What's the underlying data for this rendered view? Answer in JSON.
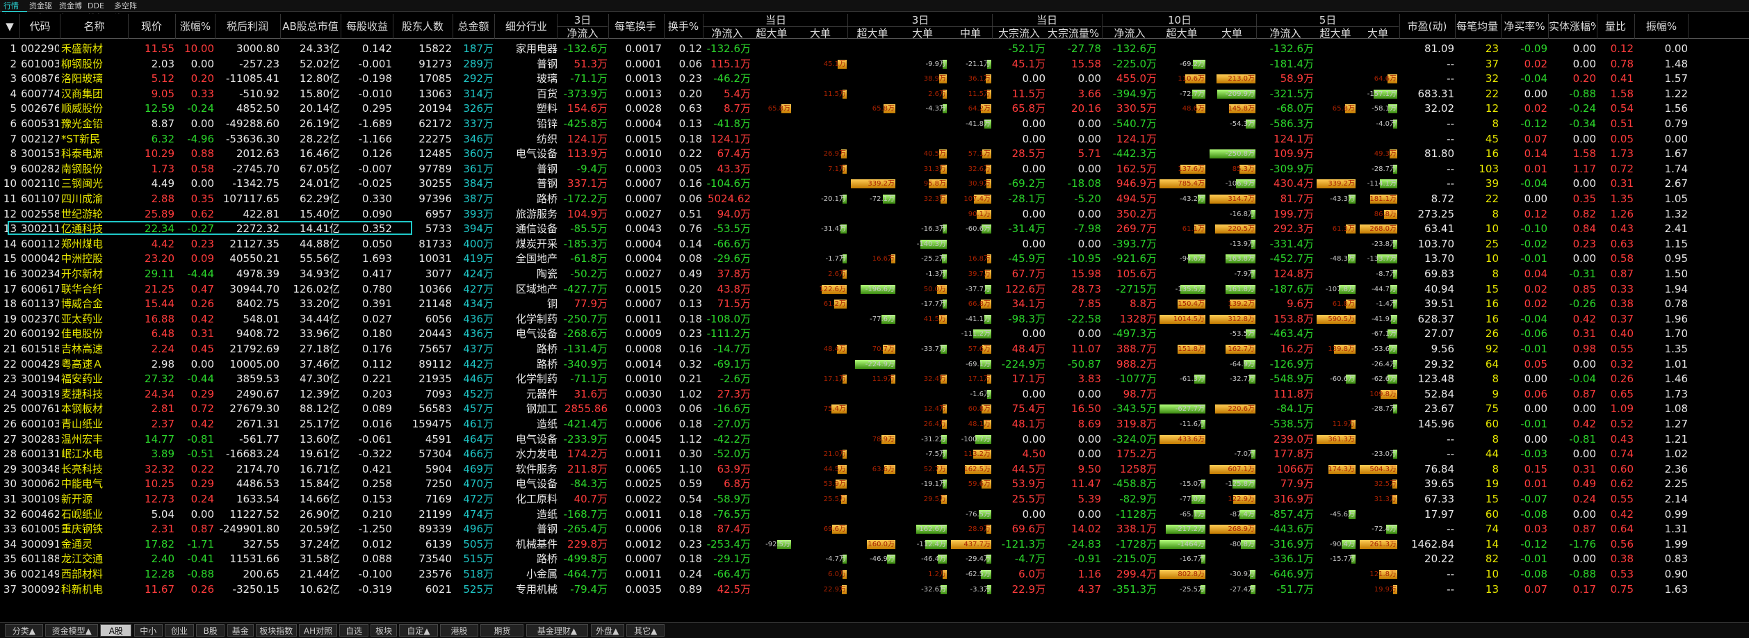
{
  "top_tabs": [
    "行情报价",
    "资金驱动力",
    "资金博弈",
    "DDE排名",
    "多空阵线"
  ],
  "headers": {
    "sort": "▼",
    "code": "代码",
    "name": "名称",
    "price": "现价",
    "chg": "涨幅%",
    "profit": "税后利润",
    "ab_total": "AB股总市值",
    "eps": "每股收益",
    "holders": "股东人数",
    "total_amt": "总金额",
    "industry": "细分行业",
    "d3": "3日",
    "d3_net": "净流入",
    "per_trade": "每笔换手",
    "turnover": "换手%",
    "today": "当日",
    "today_net": "净流入",
    "today_super": "超大单",
    "today_big": "大单",
    "d3b": "3日",
    "d3b_super": "超大单",
    "d3b_big": "大单",
    "d3b_mid": "中单",
    "today2": "当日",
    "block_in": "大宗流入",
    "block_pct": "大宗流量%",
    "d10": "10日",
    "d10_net": "净流入",
    "d10_super": "超大单",
    "d10_big": "大单",
    "d5": "5日",
    "d5_net": "净流入",
    "d5_super": "超大单",
    "d5_big": "大单",
    "pe": "市盈(动)",
    "avg_per_trade": "每笔均量",
    "net_rate": "净买率%",
    "body_chg": "实体涨幅%",
    "vol_ratio": "量比",
    "amplitude": "振幅%"
  },
  "colors": {
    "red": "#ff3c3c",
    "green": "#2bd52b",
    "cyan": "#1fc8c8",
    "yellow": "#e8e800",
    "orange_bar": "#e89a10",
    "green_bar": "#6ad43a",
    "selection": "#1fc8c8"
  },
  "selected_row": 13,
  "rows": [
    [
      "1",
      "002290",
      "禾盛新材",
      "11.55",
      "10.00",
      "3000.80",
      "24.33亿",
      "0.142",
      "15822",
      "187万",
      "家用电器",
      "-132.6万",
      "0.0017",
      "0.12",
      "-132.6万",
      "",
      "",
      "",
      "",
      "",
      "-52.1万",
      "-27.78",
      "-132.6万",
      "",
      "",
      "-132.6万",
      "",
      "",
      "81.09",
      "23",
      "-0.09",
      "0.00",
      "0.12",
      "0.00"
    ],
    [
      "2",
      "601003",
      "柳钢股份",
      "2.03",
      "0.00",
      "-257.23",
      "52.02亿",
      "-0.001",
      "91273",
      "289万",
      "普钢",
      "51.3万",
      "0.0001",
      "0.06",
      "115.1万",
      "",
      "45.1万",
      "",
      "-9.9万",
      "-21.1万",
      "45.1万",
      "15.58",
      "-225.0万",
      "-69.2万",
      "",
      "-181.4万",
      "",
      "",
      "--",
      "37",
      "0.02",
      "0.00",
      "0.78",
      "1.48"
    ],
    [
      "3",
      "600876",
      "洛阳玻璃",
      "5.12",
      "0.20",
      "-11085.41",
      "12.80亿",
      "-0.198",
      "17085",
      "292万",
      "玻璃",
      "-71.1万",
      "0.0013",
      "0.23",
      "-46.2万",
      "",
      "",
      "",
      "38.9万",
      "36.1万",
      "0.00",
      "0.00",
      "455.0万",
      "110.6万",
      "213.0万",
      "58.9万",
      "",
      "64.6万",
      "--",
      "32",
      "-0.04",
      "0.20",
      "0.41",
      "1.57"
    ],
    [
      "4",
      "600774",
      "汉商集团",
      "9.05",
      "0.33",
      "-510.92",
      "15.80亿",
      "-0.010",
      "13063",
      "314万",
      "百货",
      "-373.9万",
      "0.0013",
      "0.20",
      "5.4万",
      "",
      "11.5万",
      "",
      "2.6万",
      "11.5万",
      "11.5万",
      "3.66",
      "-394.9万",
      "-72.7万",
      "-209.9万",
      "-321.5万",
      "",
      "-157.1万",
      "683.31",
      "22",
      "0.00",
      "-0.88",
      "1.58",
      "1.22"
    ],
    [
      "5",
      "002676",
      "顺威股份",
      "12.59",
      "-0.24",
      "4852.50",
      "20.14亿",
      "0.295",
      "20194",
      "326万",
      "塑料",
      "154.6万",
      "0.0028",
      "0.63",
      "8.7万",
      "65.8万",
      "",
      "65.8万",
      "-4.3万",
      "64.2万",
      "65.8万",
      "20.16",
      "330.5万",
      "48.6万",
      "145.8万",
      "-68.0万",
      "65.8万",
      "-58.1万",
      "32.02",
      "12",
      "0.02",
      "-0.24",
      "0.54",
      "1.56"
    ],
    [
      "6",
      "600531",
      "豫光金铅",
      "8.87",
      "0.00",
      "-49288.60",
      "26.19亿",
      "-1.689",
      "62172",
      "337万",
      "铅锌",
      "-425.8万",
      "0.0004",
      "0.13",
      "-41.8万",
      "",
      "",
      "",
      "",
      "-41.8万",
      "0.00",
      "0.00",
      "-540.7万",
      "",
      "-54.3万",
      "-586.3万",
      "",
      "-4.0万",
      "--",
      "8",
      "-0.12",
      "-0.34",
      "0.51",
      "0.79"
    ],
    [
      "7",
      "002127",
      "*ST新民",
      "6.32",
      "-4.96",
      "-53636.30",
      "28.22亿",
      "-1.166",
      "22275",
      "346万",
      "纺织",
      "124.1万",
      "0.0015",
      "0.18",
      "124.1万",
      "",
      "",
      "",
      "",
      "",
      "0.00",
      "0.00",
      "124.1万",
      "",
      "",
      "124.1万",
      "",
      "",
      "--",
      "45",
      "0.07",
      "0.00",
      "0.05",
      "0.00"
    ],
    [
      "8",
      "300153",
      "科泰电源",
      "10.29",
      "0.88",
      "2012.63",
      "16.46亿",
      "0.126",
      "12485",
      "360万",
      "电气设备",
      "113.9万",
      "0.0010",
      "0.22",
      "67.4万",
      "",
      "26.9万",
      "",
      "40.5万",
      "57.1万",
      "28.5万",
      "5.71",
      "-442.3万",
      "",
      "-250.8万",
      "109.9万",
      "",
      "49.3万",
      "81.80",
      "16",
      "0.14",
      "1.58",
      "1.73",
      "1.67"
    ],
    [
      "9",
      "600282",
      "南钢股份",
      "1.73",
      "0.58",
      "-2745.70",
      "67.05亿",
      "-0.007",
      "97789",
      "361万",
      "普钢",
      "-9.4万",
      "0.0003",
      "0.05",
      "43.3万",
      "",
      "7.1万",
      "",
      "31.3万",
      "32.6万",
      "0.00",
      "0.00",
      "162.5万",
      "137.6万",
      "85.3万",
      "-309.9万",
      "",
      "-28.7万",
      "--",
      "103",
      "0.01",
      "1.17",
      "0.72",
      "1.74"
    ],
    [
      "10",
      "002110",
      "三钢闽光",
      "4.49",
      "0.00",
      "-1342.75",
      "24.01亿",
      "-0.025",
      "30255",
      "384万",
      "普钢",
      "337.1万",
      "0.0007",
      "0.16",
      "-104.6万",
      "",
      "",
      "339.2万",
      "95.8万",
      "30.9万",
      "-69.2万",
      "-18.08",
      "946.9万",
      "785.4万",
      "-106.9万",
      "430.4万",
      "339.2万",
      "-114.1万",
      "--",
      "39",
      "-0.04",
      "0.00",
      "0.31",
      "2.67"
    ],
    [
      "11",
      "601107",
      "四川成渝",
      "2.88",
      "0.35",
      "107117.65",
      "62.29亿",
      "0.330",
      "97396",
      "387万",
      "路桥",
      "-172.2万",
      "0.0007",
      "0.06",
      "5024.62",
      "",
      "-20.1万",
      "-72.1万",
      "32.3万",
      "107.4万",
      "-28.1万",
      "-5.20",
      "494.5万",
      "-43.2万",
      "314.7万",
      "81.7万",
      "-43.3万",
      "181.1万",
      "8.72",
      "22",
      "0.00",
      "0.35",
      "1.35",
      "1.05"
    ],
    [
      "12",
      "002558",
      "世纪游轮",
      "25.89",
      "0.62",
      "422.81",
      "15.40亿",
      "0.090",
      "6957",
      "393万",
      "旅游服务",
      "104.9万",
      "0.0027",
      "0.51",
      "94.0万",
      "",
      "",
      "",
      "",
      "90.1万",
      "0.00",
      "0.00",
      "350.2万",
      "",
      "-16.8万",
      "199.7万",
      "",
      "86.8万",
      "273.25",
      "8",
      "0.12",
      "0.82",
      "1.26",
      "1.32"
    ],
    [
      "13",
      "300211",
      "亿通科技",
      "22.34",
      "-0.27",
      "2272.32",
      "14.41亿",
      "0.352",
      "5733",
      "394万",
      "通信设备",
      "-85.5万",
      "0.0043",
      "0.76",
      "-53.5万",
      "",
      "-31.4万",
      "",
      "-16.3万",
      "-60.6万",
      "-31.4万",
      "-7.98",
      "269.7万",
      "61.1万",
      "220.5万",
      "292.3万",
      "61.3万",
      "268.0万",
      "63.41",
      "10",
      "-0.10",
      "0.84",
      "0.43",
      "2.41"
    ],
    [
      "14",
      "600112",
      "郑州煤电",
      "4.42",
      "0.23",
      "21127.35",
      "44.88亿",
      "0.050",
      "81733",
      "400万",
      "煤炭开采",
      "-185.3万",
      "0.0004",
      "0.14",
      "-66.6万",
      "",
      "",
      "",
      "-140.3万",
      "",
      "0.00",
      "0.00",
      "-393.7万",
      "",
      "-13.9万",
      "-331.4万",
      "",
      "-23.8万",
      "103.70",
      "25",
      "-0.02",
      "0.23",
      "0.63",
      "1.15"
    ],
    [
      "15",
      "000042",
      "中洲控股",
      "23.20",
      "0.09",
      "40550.21",
      "55.56亿",
      "1.693",
      "10031",
      "419万",
      "全国地产",
      "-61.8万",
      "0.0004",
      "0.08",
      "-29.6万",
      "",
      "-1.7万",
      "16.6万",
      "-25.2万",
      "16.8万",
      "-45.9万",
      "-10.95",
      "-921.6万",
      "-94.6万",
      "-163.8万",
      "-452.7万",
      "-48.3万",
      "-133.7万",
      "13.70",
      "10",
      "-0.01",
      "0.00",
      "0.58",
      "0.95"
    ],
    [
      "16",
      "300234",
      "开尔新材",
      "29.11",
      "-4.44",
      "4978.39",
      "34.93亿",
      "0.417",
      "3077",
      "424万",
      "陶瓷",
      "-50.2万",
      "0.0027",
      "0.49",
      "37.8万",
      "",
      "2.6万",
      "",
      "-1.3万",
      "39.7万",
      "67.7万",
      "15.98",
      "105.6万",
      "",
      "-7.9万",
      "124.8万",
      "",
      "-8.7万",
      "69.83",
      "8",
      "0.04",
      "-0.31",
      "0.87",
      "1.50"
    ],
    [
      "17",
      "600617",
      "联华合纤",
      "21.25",
      "0.47",
      "30944.70",
      "126.02亿",
      "0.780",
      "10366",
      "427万",
      "区域地产",
      "-427.7万",
      "0.0015",
      "0.20",
      "43.8万",
      "",
      "122.6万",
      "-196.6万",
      "50.0万",
      "-37.7万",
      "122.6万",
      "28.73",
      "-2715万",
      "-135.5万",
      "-161.8万",
      "-187.6万",
      "-107.8万",
      "-44.7万",
      "40.94",
      "15",
      "0.02",
      "0.85",
      "0.33",
      "1.94"
    ],
    [
      "18",
      "601137",
      "博威合金",
      "15.44",
      "0.26",
      "8402.75",
      "33.20亿",
      "0.391",
      "21148",
      "434万",
      "铜",
      "77.9万",
      "0.0007",
      "0.13",
      "71.5万",
      "",
      "61.2万",
      "",
      "-17.7万",
      "66.8万",
      "34.1万",
      "7.85",
      "8.8万",
      "150.4万",
      "139.2万",
      "9.6万",
      "61.8万",
      "-1.4万",
      "39.51",
      "16",
      "0.02",
      "-0.26",
      "0.38",
      "0.78"
    ],
    [
      "19",
      "002370",
      "亚太药业",
      "16.88",
      "0.42",
      "548.01",
      "34.44亿",
      "0.027",
      "6056",
      "436万",
      "化学制药",
      "-250.7万",
      "0.0011",
      "0.18",
      "-108.0万",
      "",
      "",
      "-77.6万",
      "41.5万",
      "-41.1万",
      "-98.3万",
      "-22.58",
      "1328万",
      "1014.5万",
      "312.8万",
      "153.8万",
      "590.5万",
      "-41.9万",
      "628.37",
      "16",
      "-0.04",
      "0.42",
      "0.37",
      "1.96"
    ],
    [
      "20",
      "600192",
      "佳电股份",
      "6.48",
      "0.31",
      "9408.72",
      "33.96亿",
      "0.180",
      "20443",
      "436万",
      "电气设备",
      "-268.6万",
      "0.0009",
      "0.23",
      "-111.2万",
      "",
      "",
      "",
      "",
      "-111.2万",
      "0.00",
      "0.00",
      "-497.3万",
      "",
      "-53.5万",
      "-463.4万",
      "",
      "-67.1万",
      "27.07",
      "26",
      "-0.06",
      "0.31",
      "0.40",
      "1.70"
    ],
    [
      "21",
      "601518",
      "吉林高速",
      "2.24",
      "0.45",
      "21792.69",
      "27.18亿",
      "0.176",
      "75657",
      "437万",
      "路桥",
      "-131.4万",
      "0.0008",
      "0.16",
      "-14.7万",
      "",
      "48.4万",
      "70.7万",
      "-33.7万",
      "57.6万",
      "48.4万",
      "11.07",
      "388.7万",
      "151.8万",
      "162.7万",
      "16.2万",
      "139.8万",
      "-53.6万",
      "9.56",
      "92",
      "-0.01",
      "0.98",
      "0.55",
      "1.35"
    ],
    [
      "22",
      "000429",
      "粤高速Ａ",
      "2.98",
      "0.00",
      "10005.00",
      "37.46亿",
      "0.112",
      "89112",
      "442万",
      "路桥",
      "-340.9万",
      "0.0014",
      "0.32",
      "-69.1万",
      "",
      "",
      "-224.9万",
      "",
      "-69.1万",
      "-224.9万",
      "-50.87",
      "988.2万",
      "",
      "-64.9万",
      "-126.9万",
      "",
      "-26.4万",
      "29.32",
      "64",
      "0.05",
      "0.00",
      "0.32",
      "1.01"
    ],
    [
      "23",
      "300194",
      "福安药业",
      "27.32",
      "-0.44",
      "3859.53",
      "47.30亿",
      "0.221",
      "21935",
      "446万",
      "化学制药",
      "-71.1万",
      "0.0010",
      "0.21",
      "-2.6万",
      "",
      "17.1万",
      "11.9万",
      "32.4万",
      "17.1万",
      "17.1万",
      "3.83",
      "-1077万",
      "-61.3万",
      "-32.7万",
      "-548.9万",
      "-60.6万",
      "-62.6万",
      "123.48",
      "8",
      "0.00",
      "-0.04",
      "0.26",
      "1.46"
    ],
    [
      "24",
      "300319",
      "麦捷科技",
      "24.34",
      "0.29",
      "2490.67",
      "12.39亿",
      "0.203",
      "7093",
      "452万",
      "元器件",
      "31.6万",
      "0.0030",
      "1.02",
      "27.3万",
      "",
      "",
      "",
      "",
      "-1.6万",
      "0.00",
      "0.00",
      "98.7万",
      "",
      "",
      "111.8万",
      "",
      "109.8万",
      "52.84",
      "9",
      "0.06",
      "0.87",
      "0.65",
      "1.73"
    ],
    [
      "25",
      "000761",
      "本钢板材",
      "2.81",
      "0.72",
      "27679.30",
      "88.12亿",
      "0.089",
      "56583",
      "457万",
      "钢加工",
      "2855.86",
      "0.0003",
      "0.06",
      "-16.6万",
      "",
      "75.4万",
      "",
      "12.4万",
      "60.8万",
      "75.4万",
      "16.50",
      "-343.5万",
      "-627.7万",
      "220.6万",
      "-84.1万",
      "",
      "-28.7万",
      "23.67",
      "75",
      "0.00",
      "0.00",
      "1.09",
      "1.08"
    ],
    [
      "26",
      "600103",
      "青山纸业",
      "2.37",
      "0.42",
      "2671.31",
      "25.17亿",
      "0.016",
      "159475",
      "461万",
      "造纸",
      "-421.4万",
      "0.0006",
      "0.18",
      "-27.0万",
      "",
      "",
      "",
      "26.4万",
      "48.1万",
      "48.1万",
      "8.69",
      "319.8万",
      "-11.6万",
      "",
      "-538.5万",
      "11.9万",
      "",
      "145.96",
      "60",
      "-0.01",
      "0.42",
      "0.52",
      "1.27"
    ],
    [
      "27",
      "300283",
      "温州宏丰",
      "14.77",
      "-0.81",
      "-561.77",
      "13.60亿",
      "-0.061",
      "4591",
      "464万",
      "电气设备",
      "-233.9万",
      "0.0045",
      "1.12",
      "-42.2万",
      "",
      "",
      "78.9万",
      "-31.2万",
      "-100.7万",
      "0.00",
      "0.00",
      "-324.0万",
      "433.6万",
      "",
      "239.0万",
      "361.3万",
      "",
      "--",
      "8",
      "0.00",
      "-0.81",
      "0.43",
      "1.21"
    ],
    [
      "28",
      "600131",
      "岷江水电",
      "3.89",
      "-0.51",
      "-16683.24",
      "19.61亿",
      "-0.322",
      "57304",
      "466万",
      "水力发电",
      "174.2万",
      "0.0011",
      "0.30",
      "-52.0万",
      "",
      "21.0万",
      "",
      "-7.5万",
      "113.2万",
      "4.50",
      "0.00",
      "175.2万",
      "",
      "-7.0万",
      "177.8万",
      "",
      "-23.0万",
      "--",
      "44",
      "-0.03",
      "0.00",
      "0.74",
      "1.02"
    ],
    [
      "29",
      "300348",
      "长亮科技",
      "32.32",
      "0.22",
      "2174.70",
      "16.71亿",
      "0.421",
      "5904",
      "469万",
      "软件服务",
      "211.8万",
      "0.0065",
      "1.10",
      "63.9万",
      "",
      "44.5万",
      "63.6万",
      "52.7万",
      "162.5万",
      "44.5万",
      "9.50",
      "1258万",
      "",
      "607.1万",
      "1066万",
      "174.3万",
      "504.3万",
      "76.84",
      "8",
      "0.15",
      "0.31",
      "0.60",
      "2.36"
    ],
    [
      "30",
      "300062",
      "中能电气",
      "10.25",
      "0.29",
      "4486.53",
      "15.84亿",
      "0.258",
      "7250",
      "470万",
      "电气设备",
      "-84.3万",
      "0.0025",
      "0.59",
      "6.8万",
      "",
      "53.9万",
      "",
      "-19.1万",
      "59.6万",
      "53.9万",
      "11.47",
      "-458.8万",
      "-15.0万",
      "-125.8万",
      "77.9万",
      "",
      "32.5万",
      "39.65",
      "19",
      "0.01",
      "0.49",
      "0.62",
      "2.25"
    ],
    [
      "31",
      "300109",
      "新开源",
      "12.73",
      "0.24",
      "1633.54",
      "14.66亿",
      "0.153",
      "7169",
      "472万",
      "化工原料",
      "40.7万",
      "0.0022",
      "0.54",
      "-58.9万",
      "",
      "25.5万",
      "",
      "29.5万",
      "",
      "25.5万",
      "5.39",
      "-82.9万",
      "-77.0万",
      "122.9万",
      "316.9万",
      "",
      "31.3万",
      "67.33",
      "15",
      "-0.07",
      "0.24",
      "0.55",
      "2.14"
    ],
    [
      "32",
      "600462",
      "石岘纸业",
      "5.04",
      "0.00",
      "11227.52",
      "26.90亿",
      "0.210",
      "21199",
      "474万",
      "造纸",
      "-168.7万",
      "0.0011",
      "0.18",
      "-76.5万",
      "",
      "",
      "",
      "",
      "-76.5万",
      "0.00",
      "0.00",
      "-1128万",
      "-65.1万",
      "-87.4万",
      "-857.4万",
      "-45.6万",
      "",
      "17.97",
      "60",
      "-0.08",
      "0.00",
      "0.42",
      "0.99"
    ],
    [
      "33",
      "601005",
      "重庆钢铁",
      "2.31",
      "0.87",
      "-249901.80",
      "20.59亿",
      "-1.250",
      "89339",
      "496万",
      "普钢",
      "-265.4万",
      "0.0006",
      "0.18",
      "87.4万",
      "",
      "69.6万",
      "",
      "-162.6万",
      "28.9万",
      "69.6万",
      "14.02",
      "338.1万",
      "-217.2万",
      "268.9万",
      "-443.6万",
      "",
      "-72.4万",
      "--",
      "74",
      "0.03",
      "0.87",
      "0.64",
      "1.31"
    ],
    [
      "34",
      "300091",
      "金通灵",
      "17.82",
      "-1.71",
      "327.55",
      "37.24亿",
      "0.012",
      "6139",
      "505万",
      "机械基件",
      "229.8万",
      "0.0012",
      "0.23",
      "-253.4万",
      "-92.5万",
      "",
      "160.0万",
      "-112.4万",
      "437.7万",
      "-121.3万",
      "-24.83",
      "-1728万",
      "-1464万",
      "-80.8万",
      "-316.9万",
      "-90.4万",
      "261.3万",
      "1462.84",
      "14",
      "-0.12",
      "-1.76",
      "0.56",
      "1.99"
    ],
    [
      "35",
      "601188",
      "龙江交通",
      "2.40",
      "-0.41",
      "11531.66",
      "31.58亿",
      "0.088",
      "73540",
      "515万",
      "路桥",
      "-499.8万",
      "0.0007",
      "0.18",
      "-29.1万",
      "",
      "-4.7万",
      "-46.9万",
      "-46.4万",
      "-29.4万",
      "-4.7万",
      "-0.91",
      "-215.0万",
      "-16.7万",
      "",
      "-336.1万",
      "-15.7万",
      "",
      "20.22",
      "82",
      "-0.01",
      "0.00",
      "0.38",
      "0.83"
    ],
    [
      "36",
      "002149",
      "西部材料",
      "12.28",
      "-0.88",
      "200.65",
      "21.44亿",
      "-0.100",
      "23576",
      "518万",
      "小金属",
      "-464.7万",
      "0.0011",
      "0.24",
      "-66.4万",
      "",
      "6.0万",
      "",
      "1.2万",
      "-62.5万",
      "6.0万",
      "1.16",
      "299.4万",
      "802.8万",
      "-30.9万",
      "-646.9万",
      "",
      "121.8万",
      "--",
      "10",
      "-0.08",
      "-0.88",
      "0.53",
      "0.90"
    ],
    [
      "37",
      "300092",
      "科新机电",
      "11.67",
      "0.26",
      "-3250.15",
      "10.62亿",
      "-0.319",
      "6021",
      "525万",
      "专用机械",
      "-79.4万",
      "0.0035",
      "0.89",
      "42.5万",
      "",
      "22.9万",
      "",
      "-32.6万",
      "-3.3万",
      "22.9万",
      "4.37",
      "-351.3万",
      "-25.5万",
      "-27.4万",
      "-51.7万",
      "",
      "19.9万",
      "--",
      "13",
      "0.07",
      "0.17",
      "0.75",
      "1.63"
    ]
  ],
  "bottom_tabs": [
    "分类▲",
    "资金模型▲",
    "A股",
    "中小",
    "创业",
    "B股",
    "基金",
    "板块指数",
    "AH对照",
    "自选",
    "板块",
    "自定▲",
    "港股",
    "期货",
    "基金理财▲",
    "外盘▲",
    "其它▲"
  ]
}
